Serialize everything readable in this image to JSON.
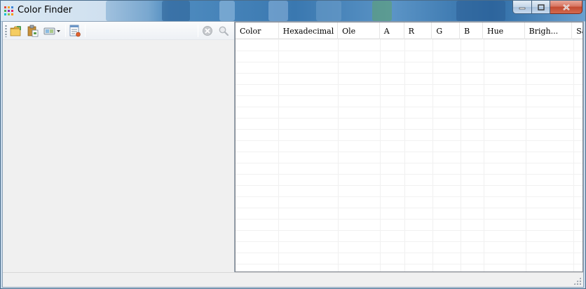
{
  "window": {
    "title": "Color Finder",
    "caption_buttons": {
      "minimize_icon": "minimize-icon",
      "maximize_icon": "maximize-icon",
      "close_icon": "close-icon"
    }
  },
  "toolbar": {
    "buttons": [
      {
        "icon": "open-folder-icon"
      },
      {
        "icon": "paste-icon"
      },
      {
        "icon": "capture-dropdown-icon"
      },
      {
        "icon": "export-list-icon"
      }
    ],
    "right_buttons": [
      {
        "icon": "clear-icon"
      },
      {
        "icon": "search-icon"
      }
    ]
  },
  "list": {
    "columns": [
      "Color",
      "Hexadecimal",
      "Ole",
      "A",
      "R",
      "G",
      "B",
      "Hue",
      "Brigh...",
      "Sa"
    ],
    "rows": []
  },
  "colors": {
    "title_accent": "#3a78b0",
    "client_bg": "#f0f0f0",
    "list_bg": "#ffffff",
    "close_red": "#c24a31"
  }
}
